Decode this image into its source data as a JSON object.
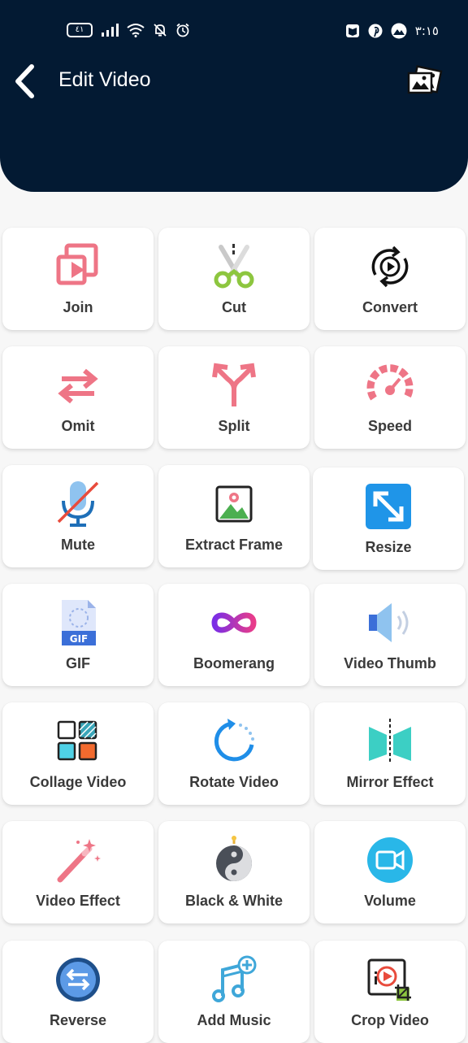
{
  "status_bar": {
    "battery": "٤١",
    "time": "٣:١٥"
  },
  "header": {
    "title": "Edit Video"
  },
  "tools": [
    {
      "label": "Join",
      "icon": "join-icon"
    },
    {
      "label": "Cut",
      "icon": "scissors-icon"
    },
    {
      "label": "Convert",
      "icon": "convert-icon"
    },
    {
      "label": "Omit",
      "icon": "omit-arrows-icon"
    },
    {
      "label": "Split",
      "icon": "split-arrows-icon"
    },
    {
      "label": "Speed",
      "icon": "speedometer-icon"
    },
    {
      "label": "Mute",
      "icon": "muted-microphone-icon"
    },
    {
      "label": "Extract Frame",
      "icon": "picture-frame-icon"
    },
    {
      "label": "Resize",
      "icon": "resize-arrows-icon"
    },
    {
      "label": "GIF",
      "icon": "gif-file-icon"
    },
    {
      "label": "Boomerang",
      "icon": "infinity-icon"
    },
    {
      "label": "Video Thumb",
      "icon": "speaker-icon"
    },
    {
      "label": "Collage Video",
      "icon": "collage-grid-icon"
    },
    {
      "label": "Rotate Video",
      "icon": "rotate-icon"
    },
    {
      "label": "Mirror Effect",
      "icon": "mirror-icon"
    },
    {
      "label": "Video Effect",
      "icon": "magic-wand-icon"
    },
    {
      "label": "Black & White",
      "icon": "yin-yang-bomb-icon"
    },
    {
      "label": "Volume",
      "icon": "video-camera-icon"
    },
    {
      "label": "Reverse",
      "icon": "reverse-arrows-icon"
    },
    {
      "label": "Add Music",
      "icon": "music-note-plus-icon"
    },
    {
      "label": "Crop Video",
      "icon": "crop-video-icon"
    }
  ]
}
